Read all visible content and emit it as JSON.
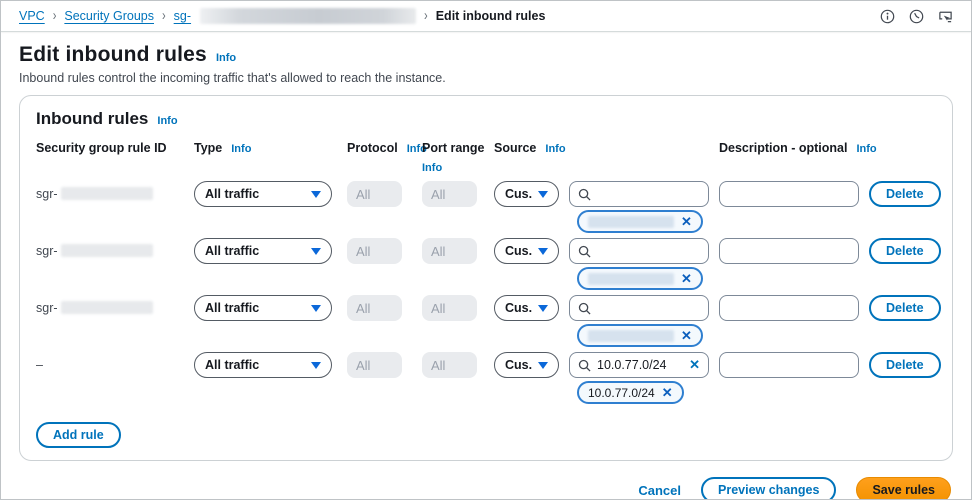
{
  "breadcrumb": {
    "items": [
      "VPC",
      "Security Groups",
      "sg-",
      "Edit inbound rules"
    ],
    "separator": "›"
  },
  "topbar": {
    "icons": [
      "info-icon",
      "history-icon",
      "feedback-icon"
    ]
  },
  "page": {
    "title": "Edit inbound rules",
    "info_label": "Info",
    "subtitle": "Inbound rules control the incoming traffic that's allowed to reach the instance."
  },
  "panel": {
    "title": "Inbound rules",
    "info_label": "Info",
    "columns": {
      "rule_id": "Security group rule ID",
      "type": "Type",
      "protocol": "Protocol",
      "port_range": "Port range",
      "source": "Source",
      "description": "Description - optional",
      "info_label": "Info"
    },
    "rows": [
      {
        "rule_id": "sgr-",
        "type": "All traffic",
        "protocol": "All",
        "port_range": "All",
        "source_type": "Cus...",
        "search_value": "",
        "token": "",
        "description": "",
        "delete_label": "Delete"
      },
      {
        "rule_id": "sgr-",
        "type": "All traffic",
        "protocol": "All",
        "port_range": "All",
        "source_type": "Cus...",
        "search_value": "",
        "token": "",
        "description": "",
        "delete_label": "Delete"
      },
      {
        "rule_id": "sgr-",
        "type": "All traffic",
        "protocol": "All",
        "port_range": "All",
        "source_type": "Cus...",
        "search_value": "",
        "token": "",
        "description": "",
        "delete_label": "Delete"
      },
      {
        "rule_id": "–",
        "type": "All traffic",
        "protocol": "All",
        "port_range": "All",
        "source_type": "Cus...",
        "search_value": "10.0.77.0/24",
        "token": "10.0.77.0/24",
        "description": "",
        "delete_label": "Delete"
      }
    ],
    "add_rule_label": "Add rule"
  },
  "footer": {
    "cancel_label": "Cancel",
    "preview_label": "Preview changes",
    "save_label": "Save rules"
  },
  "colors": {
    "link_blue": "#0073bb",
    "caret_blue": "#0b68d9",
    "primary_orange": "#ff9900",
    "input_border": "#7d8998",
    "dropdown_border": "#545b64",
    "disabled_bg": "#e9ebee",
    "chip_border": "#2f7fd0",
    "chip_bg": "#f4f9fd",
    "text_dark": "#16191f",
    "text_secondary": "#414750"
  }
}
